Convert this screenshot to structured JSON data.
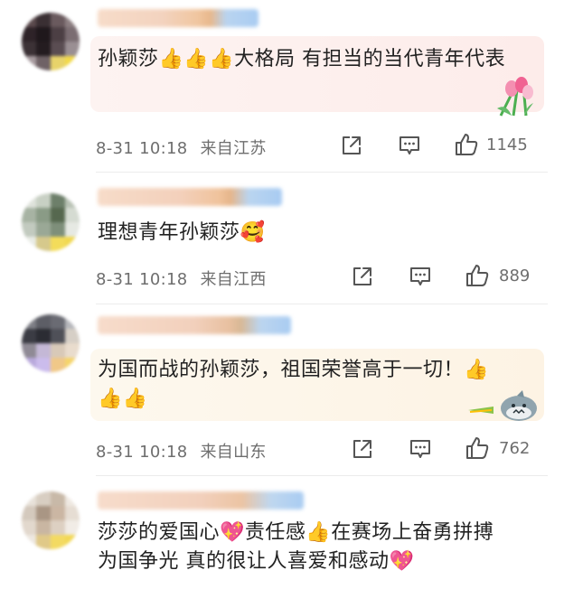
{
  "comments": [
    {
      "text": "孙颖莎👍👍👍大格局 有担当的当代青年代表",
      "time": "8-31 10:18",
      "location": "来自江苏",
      "likes": "1145"
    },
    {
      "text": "理想青年孙颖莎🥰",
      "time": "8-31 10:18",
      "location": "来自江西",
      "likes": "889"
    },
    {
      "text": "为国而战的孙颖莎，祖国荣誉高于一切！👍👍👍",
      "time": "8-31 10:18",
      "location": "来自山东",
      "likes": "762"
    },
    {
      "text": "莎莎的爱国心💖责任感👍在赛场上奋勇拼搏 为国争光 真的很让人喜爱和感动💖"
    }
  ],
  "icons": {
    "share": "share-icon",
    "comment": "comment-icon",
    "like": "thumbs-up-icon"
  },
  "colors": {
    "bubble_pink": "#fdf0ef",
    "bubble_cream": "#fdf5e8",
    "meta_text": "#6e6e6e"
  }
}
